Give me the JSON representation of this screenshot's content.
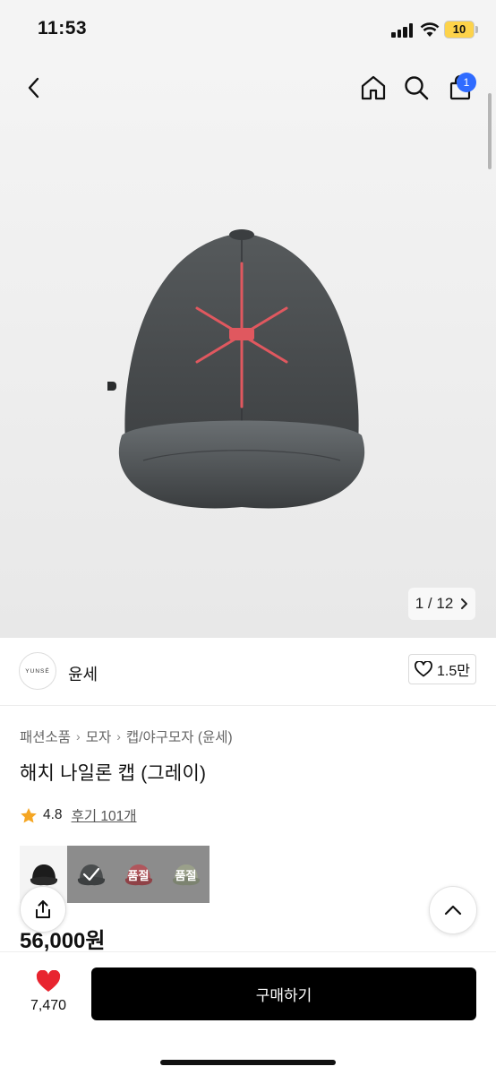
{
  "status_bar": {
    "time": "11:53",
    "battery": "10"
  },
  "header": {
    "cart_count": "1"
  },
  "gallery": {
    "current": "1",
    "separator": "/",
    "total": "12"
  },
  "brand": {
    "logo_text": "YUNSÉ",
    "name": "윤세",
    "likes": "1.5만"
  },
  "breadcrumb": [
    "패션소품",
    "모자",
    "캡/야구모자 (윤세)"
  ],
  "product": {
    "title": "해치 나일론 캡 (그레이)",
    "rating": "4.8",
    "reviews": "후기 101개",
    "price": "56,000원"
  },
  "options": [
    {
      "color": "#1c1c1c",
      "state": "available",
      "label": ""
    },
    {
      "color": "#4a4d4e",
      "state": "selected",
      "label": ""
    },
    {
      "color": "#b0565c",
      "state": "soldout",
      "label": "품절"
    },
    {
      "color": "#9aa08a",
      "state": "soldout",
      "label": "품절"
    }
  ],
  "bottom_bar": {
    "wish_count": "7,470",
    "buy_label": "구매하기"
  },
  "colors": {
    "accent_blue": "#2f6bff",
    "heart_red": "#e8242f",
    "star_orange": "#f5a623",
    "buy_black": "#000000"
  }
}
